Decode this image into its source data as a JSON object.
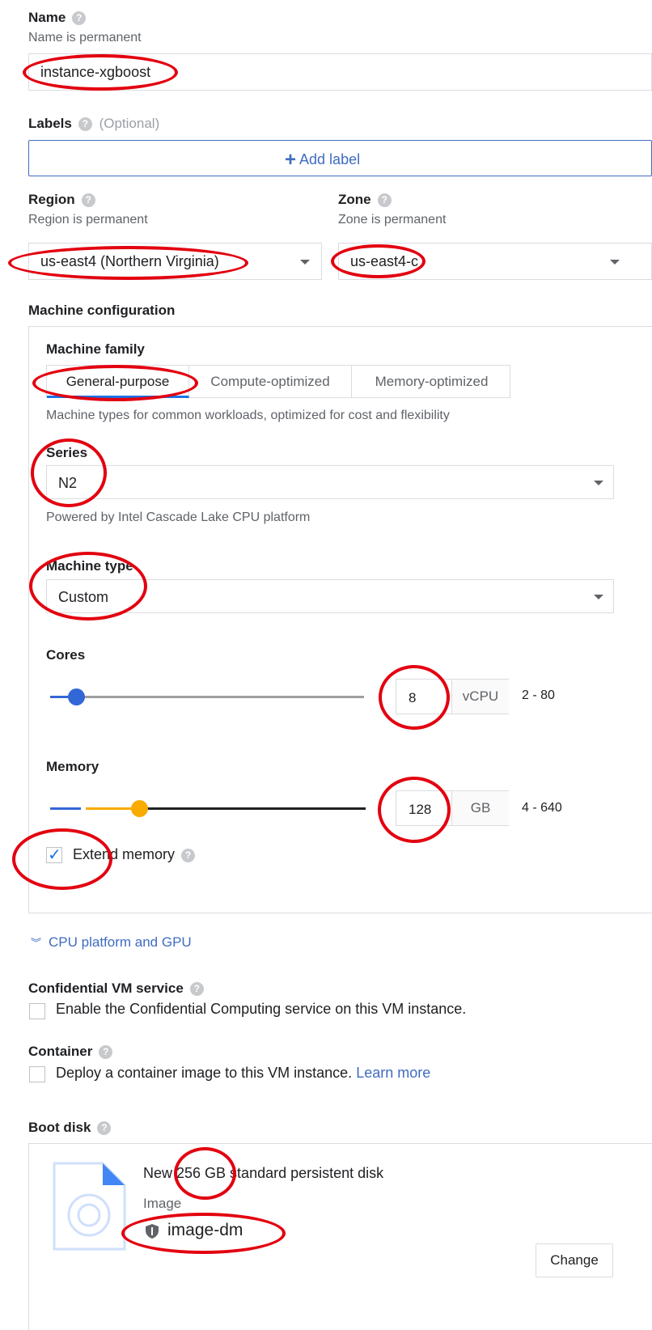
{
  "name": {
    "label": "Name",
    "hint": "Name is permanent",
    "value": "instance-xgboost"
  },
  "labels": {
    "label": "Labels",
    "optional": "(Optional)",
    "add_label": "Add label"
  },
  "region": {
    "label": "Region",
    "hint": "Region is permanent",
    "value": "us-east4 (Northern Virginia)"
  },
  "zone": {
    "label": "Zone",
    "hint": "Zone is permanent",
    "value": "us-east4-c"
  },
  "machine_config": {
    "heading": "Machine configuration",
    "family_label": "Machine family",
    "tabs": [
      "General-purpose",
      "Compute-optimized",
      "Memory-optimized"
    ],
    "active_tab": 0,
    "family_desc": "Machine types for common workloads, optimized for cost and flexibility",
    "series_label": "Series",
    "series_value": "N2",
    "series_desc": "Powered by Intel Cascade Lake CPU platform",
    "machine_type_label": "Machine type",
    "machine_type_value": "Custom",
    "cores": {
      "label": "Cores",
      "value": "8",
      "unit": "vCPU",
      "range": "2 - 80",
      "slider_fraction": 0.082
    },
    "memory": {
      "label": "Memory",
      "value": "128",
      "unit": "GB",
      "range": "4 - 640",
      "slider_fraction": 0.19
    },
    "extend_memory": {
      "label": "Extend memory",
      "checked": true
    }
  },
  "cpu_platform_link": "CPU platform and GPU",
  "confidential": {
    "label": "Confidential VM service",
    "checkbox_label": "Enable the Confidential Computing service on this VM instance.",
    "checked": false
  },
  "container": {
    "label": "Container",
    "checkbox_label": "Deploy a container image to this VM instance.",
    "learn_more": "Learn more",
    "checked": false
  },
  "boot_disk": {
    "label": "Boot disk",
    "title": "New 256 GB standard persistent disk",
    "image_label": "Image",
    "image_name": "image-dm",
    "change_button": "Change"
  },
  "colors": {
    "accent": "#1a73e8",
    "memory_slider": "#f9ab00",
    "annotation": "#e3000f",
    "link": "#3f6cc1"
  }
}
